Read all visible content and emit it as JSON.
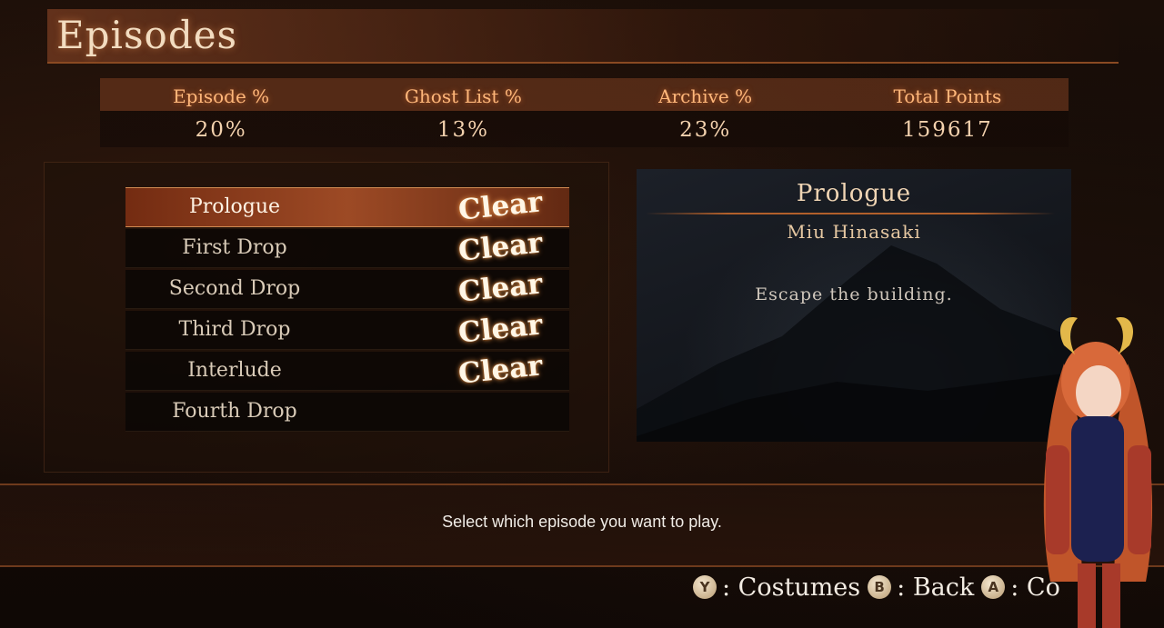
{
  "header": {
    "title": "Episodes"
  },
  "stats": [
    {
      "label": "Episode %",
      "value": "20%"
    },
    {
      "label": "Ghost List %",
      "value": "13%"
    },
    {
      "label": "Archive %",
      "value": "23%"
    },
    {
      "label": "Total Points",
      "value": "159617"
    }
  ],
  "episodes": [
    {
      "name": "Prologue",
      "status": "Clear",
      "selected": true
    },
    {
      "name": "First Drop",
      "status": "Clear"
    },
    {
      "name": "Second Drop",
      "status": "Clear"
    },
    {
      "name": "Third Drop",
      "status": "Clear"
    },
    {
      "name": "Interlude",
      "status": "Clear"
    },
    {
      "name": "Fourth Drop",
      "status": ""
    }
  ],
  "detail": {
    "title": "Prologue",
    "character": "Miu Hinasaki",
    "objective": "Escape the building."
  },
  "hint": "Select which episode you want to play.",
  "controls": [
    {
      "button": "Y",
      "label": ": Costumes"
    },
    {
      "button": "B",
      "label": ": Back"
    },
    {
      "button": "A",
      "label": ": Co"
    }
  ],
  "colors": {
    "accent": "#b2602b",
    "highlight": "#ffb77a",
    "text": "#e8d9c4"
  },
  "icons": {
    "button_y": "y-button-icon",
    "button_b": "b-button-icon",
    "button_a": "a-button-icon"
  }
}
